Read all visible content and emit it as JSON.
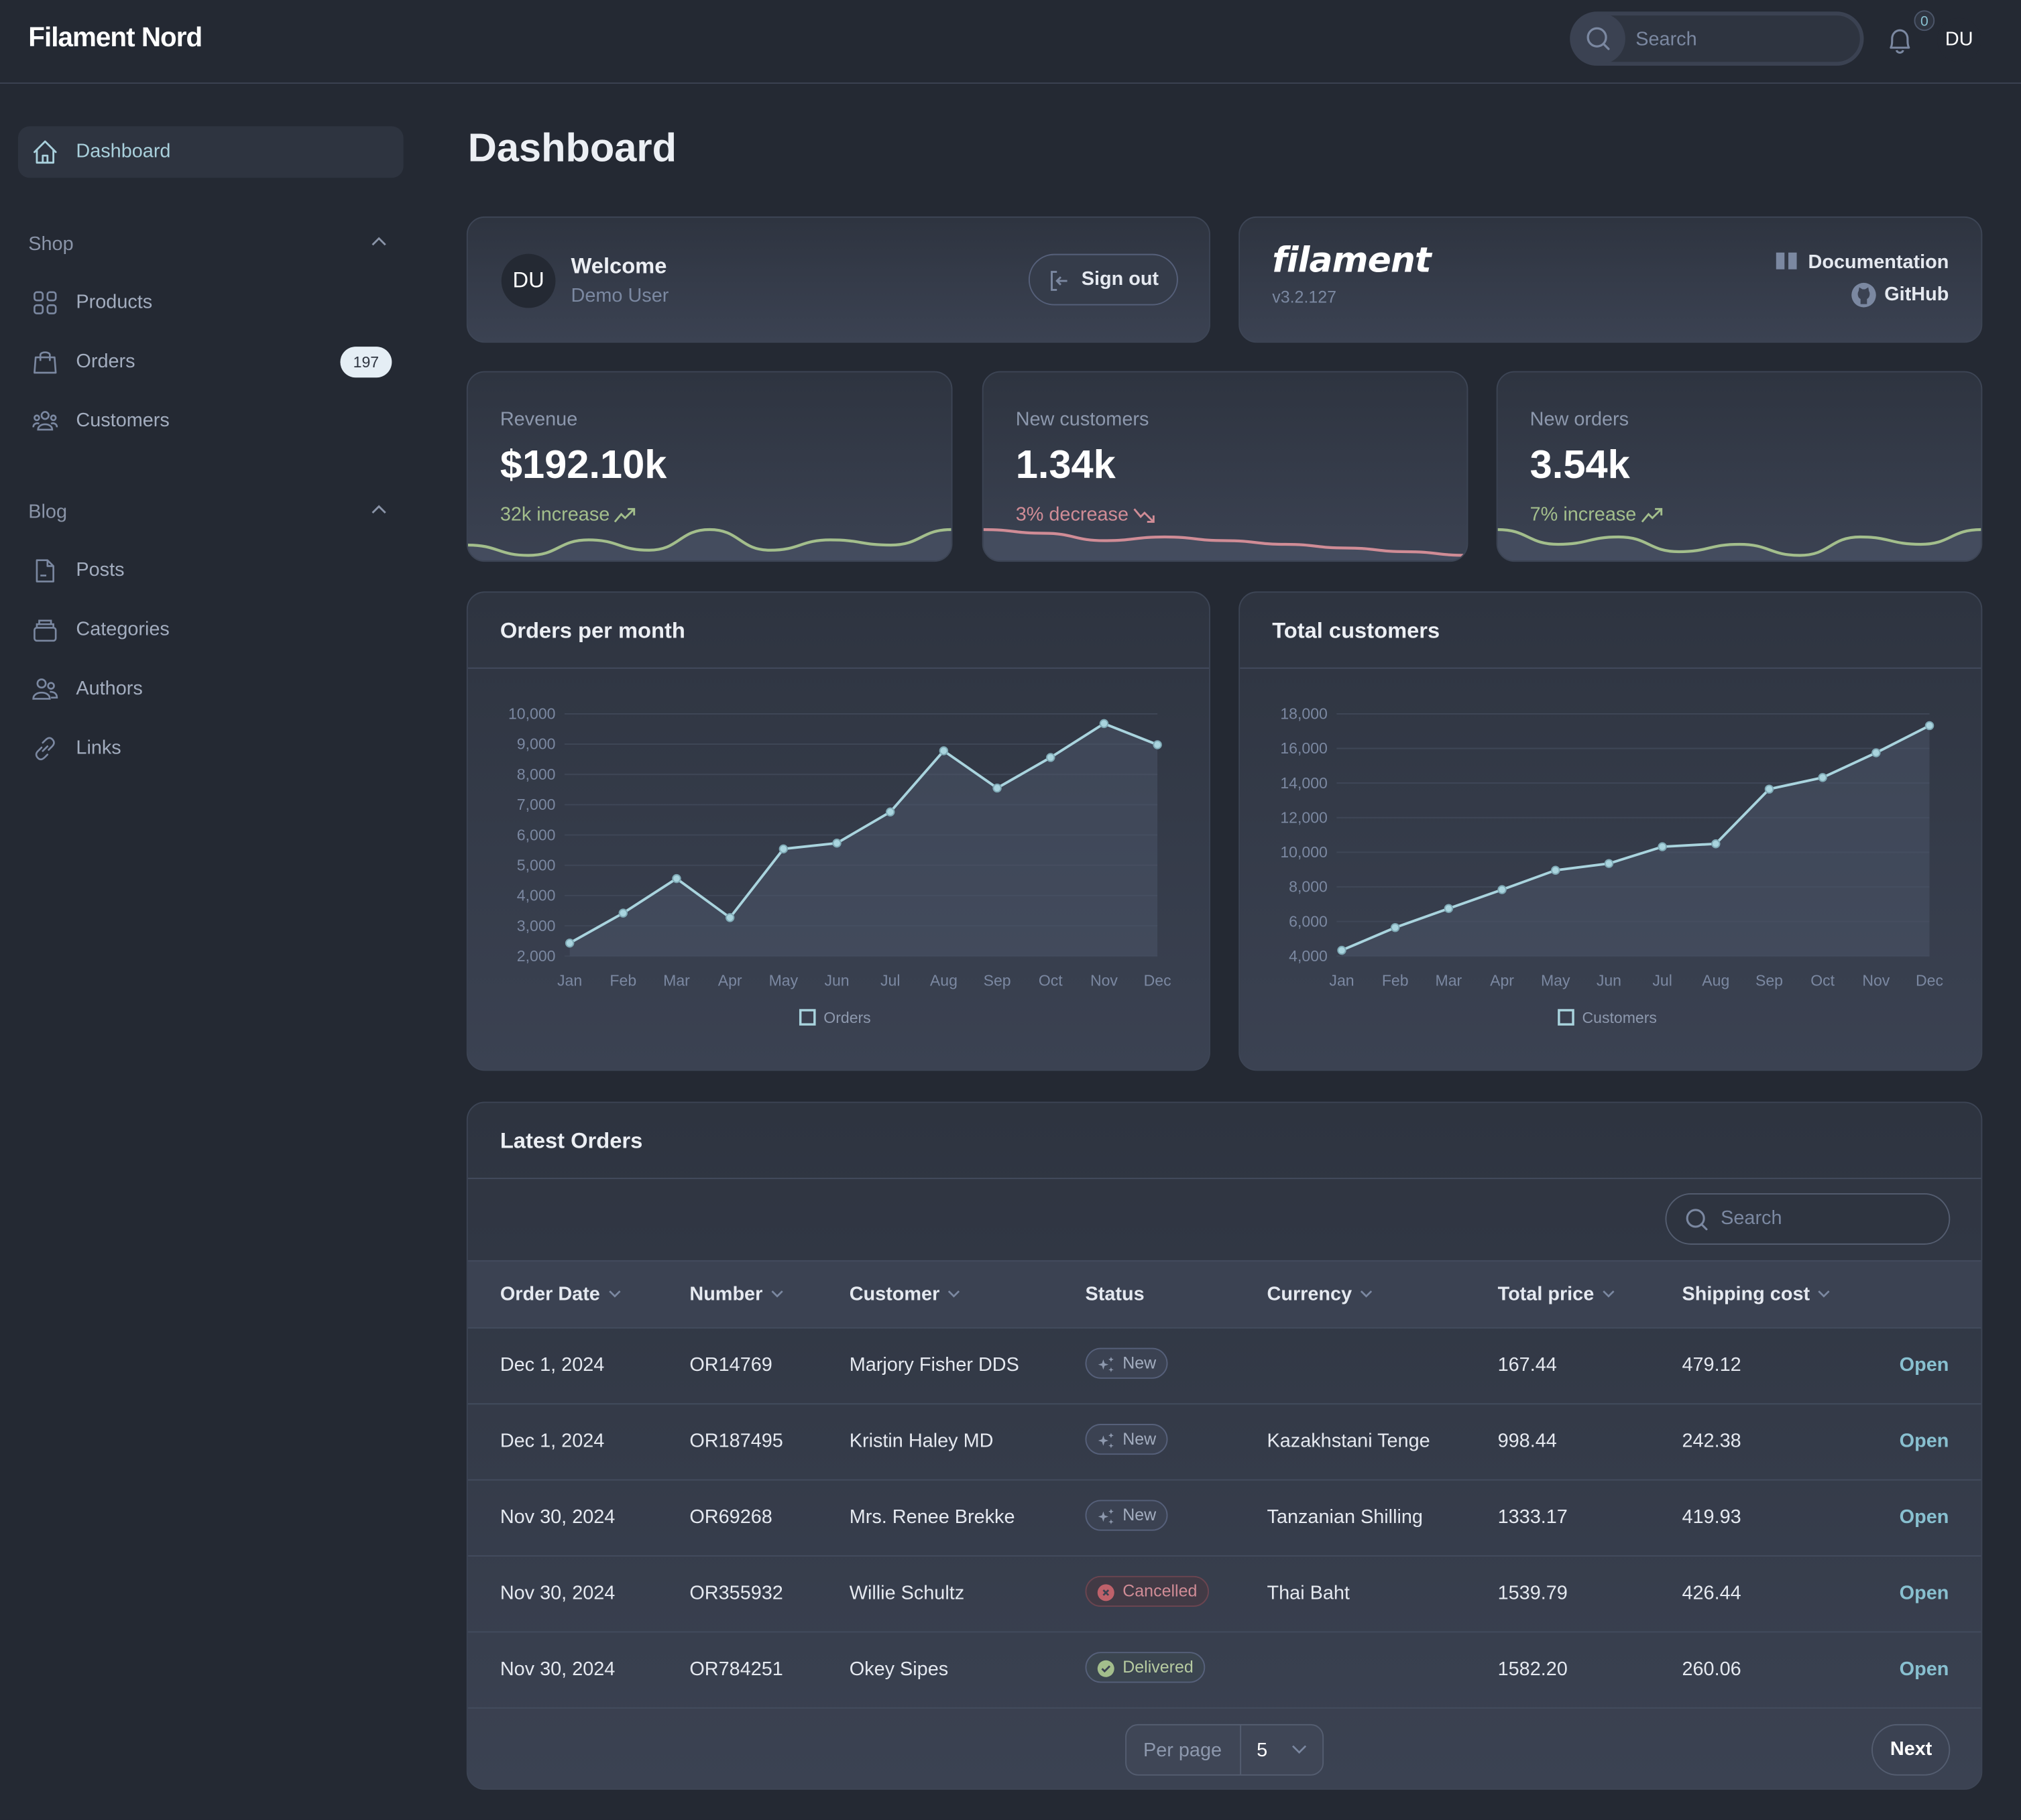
{
  "app": {
    "title": "Filament Nord"
  },
  "topbar": {
    "search_placeholder": "Search",
    "notifications_count": "0",
    "user_initials": "DU"
  },
  "sidebar": {
    "dashboard": {
      "label": "Dashboard",
      "icon": "home-icon"
    },
    "groups": [
      {
        "title": "Shop",
        "items": [
          {
            "label": "Products",
            "icon": "squares-icon"
          },
          {
            "label": "Orders",
            "icon": "shopping-bag-icon",
            "badge": "197"
          },
          {
            "label": "Customers",
            "icon": "user-group-icon"
          }
        ]
      },
      {
        "title": "Blog",
        "items": [
          {
            "label": "Posts",
            "icon": "document-icon"
          },
          {
            "label": "Categories",
            "icon": "rectangle-stack-icon"
          },
          {
            "label": "Authors",
            "icon": "users-icon"
          },
          {
            "label": "Links",
            "icon": "link-icon"
          }
        ]
      }
    ]
  },
  "page": {
    "title": "Dashboard"
  },
  "account": {
    "initials": "DU",
    "welcome": "Welcome",
    "name": "Demo User",
    "sign_out": "Sign out"
  },
  "filament": {
    "logo": "filament",
    "version": "v3.2.127",
    "documentation": "Documentation",
    "github": "GitHub"
  },
  "stats": [
    {
      "label": "Revenue",
      "value": "$192.10k",
      "description": "32k increase",
      "trend": "up",
      "color": "#a3be8c",
      "spark": [
        3,
        1,
        4,
        2,
        6,
        2,
        4,
        3,
        6
      ]
    },
    {
      "label": "New customers",
      "value": "1.34k",
      "description": "3% decrease",
      "trend": "down",
      "color": "#d08c96",
      "spark": [
        6,
        5.5,
        4.5,
        5,
        4.5,
        4,
        3.5,
        3,
        2.5
      ]
    },
    {
      "label": "New orders",
      "value": "3.54k",
      "description": "7% increase",
      "trend": "up",
      "color": "#a3be8c",
      "spark": [
        5,
        3,
        4,
        2,
        3,
        1.5,
        4,
        3,
        5
      ]
    }
  ],
  "chart_data": [
    {
      "type": "line",
      "title": "Orders per month",
      "categories": [
        "Jan",
        "Feb",
        "Mar",
        "Apr",
        "May",
        "Jun",
        "Jul",
        "Aug",
        "Sep",
        "Oct",
        "Nov",
        "Dec"
      ],
      "series": [
        {
          "name": "Orders",
          "values": [
            2430,
            3420,
            4560,
            3270,
            5540,
            5730,
            6760,
            8780,
            7550,
            8560,
            9680,
            8980
          ]
        }
      ],
      "ylim": [
        2000,
        10000
      ],
      "yticks": [
        "2,000",
        "3,000",
        "4,000",
        "5,000",
        "6,000",
        "7,000",
        "8,000",
        "9,000",
        "10,000"
      ],
      "ytick_values": [
        2000,
        3000,
        4000,
        5000,
        6000,
        7000,
        8000,
        9000,
        10000
      ],
      "grid": true,
      "legend": "bottom",
      "fill": true,
      "xlabel": "",
      "ylabel": ""
    },
    {
      "type": "line",
      "title": "Total customers",
      "categories": [
        "Jan",
        "Feb",
        "Mar",
        "Apr",
        "May",
        "Jun",
        "Jul",
        "Aug",
        "Sep",
        "Oct",
        "Nov",
        "Dec"
      ],
      "series": [
        {
          "name": "Customers",
          "values": [
            4335,
            5650,
            6750,
            7840,
            8960,
            9350,
            10320,
            10490,
            13650,
            14320,
            15750,
            17320
          ]
        }
      ],
      "ylim": [
        4000,
        18000
      ],
      "yticks": [
        "4,000",
        "6,000",
        "8,000",
        "10,000",
        "12,000",
        "14,000",
        "16,000",
        "18,000"
      ],
      "ytick_values": [
        4000,
        6000,
        8000,
        10000,
        12000,
        14000,
        16000,
        18000
      ],
      "grid": true,
      "legend": "bottom",
      "fill": true,
      "xlabel": "",
      "ylabel": ""
    }
  ],
  "colors": {
    "accent": "#88c0d0",
    "line": "#a9d4de",
    "success": "#a3be8c",
    "danger": "#bf616a"
  },
  "orders_table": {
    "title": "Latest Orders",
    "search_placeholder": "Search",
    "columns": [
      {
        "label": "Order Date",
        "sortable": true
      },
      {
        "label": "Number",
        "sortable": true
      },
      {
        "label": "Customer",
        "sortable": true
      },
      {
        "label": "Status",
        "sortable": false
      },
      {
        "label": "Currency",
        "sortable": true
      },
      {
        "label": "Total price",
        "sortable": true
      },
      {
        "label": "Shipping cost",
        "sortable": true
      }
    ],
    "rows": [
      {
        "date": "Dec 1, 2024",
        "number": "OR14769",
        "customer": "Marjory Fisher DDS",
        "status": "New",
        "currency": "",
        "total": "167.44",
        "shipping": "479.12",
        "action": "Open"
      },
      {
        "date": "Dec 1, 2024",
        "number": "OR187495",
        "customer": "Kristin Haley MD",
        "status": "New",
        "currency": "Kazakhstani Tenge",
        "total": "998.44",
        "shipping": "242.38",
        "action": "Open"
      },
      {
        "date": "Nov 30, 2024",
        "number": "OR69268",
        "customer": "Mrs. Renee Brekke",
        "status": "New",
        "currency": "Tanzanian Shilling",
        "total": "1333.17",
        "shipping": "419.93",
        "action": "Open"
      },
      {
        "date": "Nov 30, 2024",
        "number": "OR355932",
        "customer": "Willie Schultz",
        "status": "Cancelled",
        "currency": "Thai Baht",
        "total": "1539.79",
        "shipping": "426.44",
        "action": "Open"
      },
      {
        "date": "Nov 30, 2024",
        "number": "OR784251",
        "customer": "Okey Sipes",
        "status": "Delivered",
        "currency": "",
        "total": "1582.20",
        "shipping": "260.06",
        "action": "Open"
      }
    ],
    "pagination": {
      "per_page_label": "Per page",
      "per_page_value": "5",
      "next": "Next"
    }
  }
}
